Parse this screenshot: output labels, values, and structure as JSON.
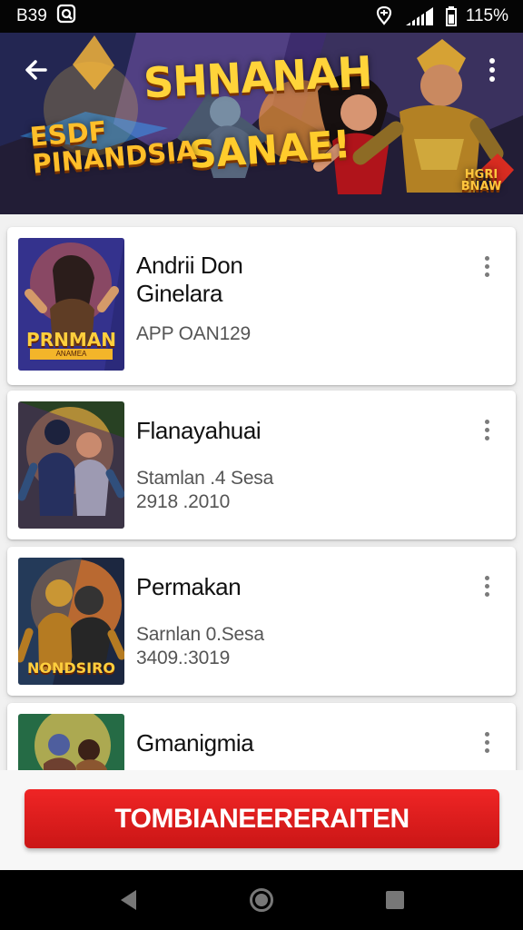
{
  "status": {
    "time": "B39",
    "battery": "115%",
    "icons": [
      "notification-icon",
      "location-icon",
      "signal-icon",
      "battery-icon"
    ]
  },
  "banner": {
    "title_main": "SHNANAH",
    "title_sub": "SANAE!",
    "badge": "ESDF\nPINANDSIA",
    "tag": "HGRI\nBNAW",
    "icons": [
      "back-arrow-icon",
      "overflow-menu-icon"
    ]
  },
  "cards": [
    {
      "title": "Andrii Don\nGinelara",
      "meta_1": "APP OAN129",
      "thumb_label": "PRNMAN",
      "thumb_sub": "ANAMEA"
    },
    {
      "title": "Flanayahuai",
      "meta_1": "Stamlan .4 Sesa",
      "meta_2": "2918 .2010",
      "thumb_label": ""
    },
    {
      "title": "Permakan",
      "meta_1": "Sarnlan 0.Sesa",
      "meta_2": "3409.:3019",
      "thumb_label": "NONDSIRO"
    },
    {
      "title": "Gmanigmia",
      "thumb_label": ""
    }
  ],
  "action": {
    "button_label": "TOMBIANEERERAITEN"
  },
  "colors": {
    "accent": "#e42222",
    "status_bar": "#050505",
    "navigation_bar": "#000000"
  },
  "navigation_icons": [
    "back-triangle-icon",
    "home-circle-icon",
    "recents-square-icon"
  ]
}
